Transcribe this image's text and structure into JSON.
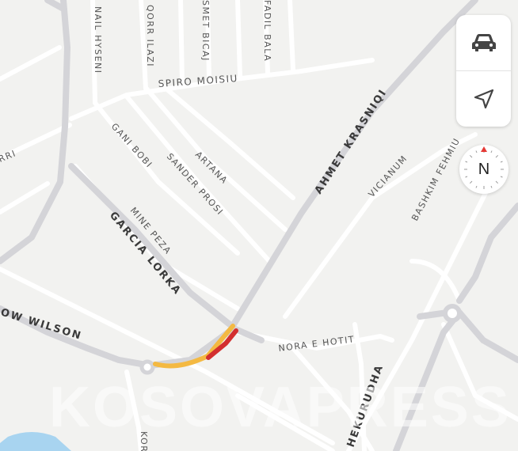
{
  "map": {
    "streets": {
      "nail_hyseni": "NAIL HYSENI",
      "qorr_ilazi": "QORR ILAZI",
      "ismet_bicaj": "SMET BICAJ",
      "fadil_bala": "FADIL BALA",
      "spiro_moisiu": "SPIRO MOISIU",
      "rri": "RRI",
      "gani_bobi": "GANI BOBI",
      "artana": "ARTANA",
      "sander_prosi": "SANDER PROSI",
      "ahmet_krasniqi": "AHMET KRASNIQI",
      "vicianum": "VICIANUM",
      "bashkim_fehmiu": "BASHKIM FEHMIU",
      "mine_peza": "MINE PEZA",
      "garcia_lorka": "GARCIA LORKA",
      "woodrow_wilson": "OW WILSON",
      "nora_e_hotit": "NORA E HOTIT",
      "hekurudha": "HEKURUDHA",
      "kor": "KOR"
    },
    "traffic_colors": {
      "slow": "#f4b942",
      "heavy": "#d32f2f"
    },
    "road_color": "#ffffff",
    "major_road_color": "#d4d4d8",
    "water_color": "#a8d4f0"
  },
  "controls": {
    "car_icon": "car-icon",
    "location_icon": "navigation-arrow-icon"
  },
  "compass": {
    "label": "N",
    "needle_color": "#e53935"
  },
  "watermark": {
    "text": "KOSOVAPRESS"
  }
}
